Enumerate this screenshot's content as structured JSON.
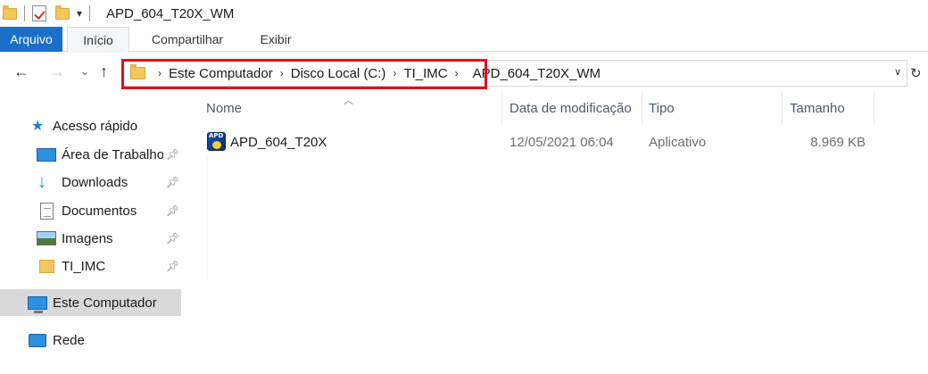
{
  "window": {
    "title": "APD_604_T20X_WM"
  },
  "ribbon": {
    "tabs": [
      "Arquivo",
      "Início",
      "Compartilhar",
      "Exibir"
    ]
  },
  "address": {
    "crumbs": [
      "Este Computador",
      "Disco Local (C:)",
      "TI_IMC",
      "APD_604_T20X_WM"
    ]
  },
  "nav_icons": {
    "back": "back-arrow-icon",
    "forward": "forward-arrow-icon",
    "recent": "chevron-down-icon",
    "up": "up-arrow-icon",
    "refresh": "refresh-icon"
  },
  "sidebar": {
    "quick_access": "Acesso rápido",
    "pinned": [
      {
        "label": "Área de Trabalho",
        "icon": "desktop-icon"
      },
      {
        "label": "Downloads",
        "icon": "downloads-icon"
      },
      {
        "label": "Documentos",
        "icon": "documents-icon"
      },
      {
        "label": "Imagens",
        "icon": "pictures-icon"
      },
      {
        "label": "TI_IMC",
        "icon": "folder-icon"
      }
    ],
    "this_pc": "Este Computador",
    "network": "Rede"
  },
  "columns": {
    "name": "Nome",
    "date": "Data de modificação",
    "type": "Tipo",
    "size": "Tamanho"
  },
  "files": [
    {
      "name": "APD_604_T20X",
      "date": "12/05/2021 06:04",
      "type": "Aplicativo",
      "size": "8.969 KB",
      "icon": "application-icon"
    }
  ],
  "colors": {
    "accent": "#1a6fc9",
    "highlight_box": "#e0101a",
    "folder": "#f2c75c"
  }
}
